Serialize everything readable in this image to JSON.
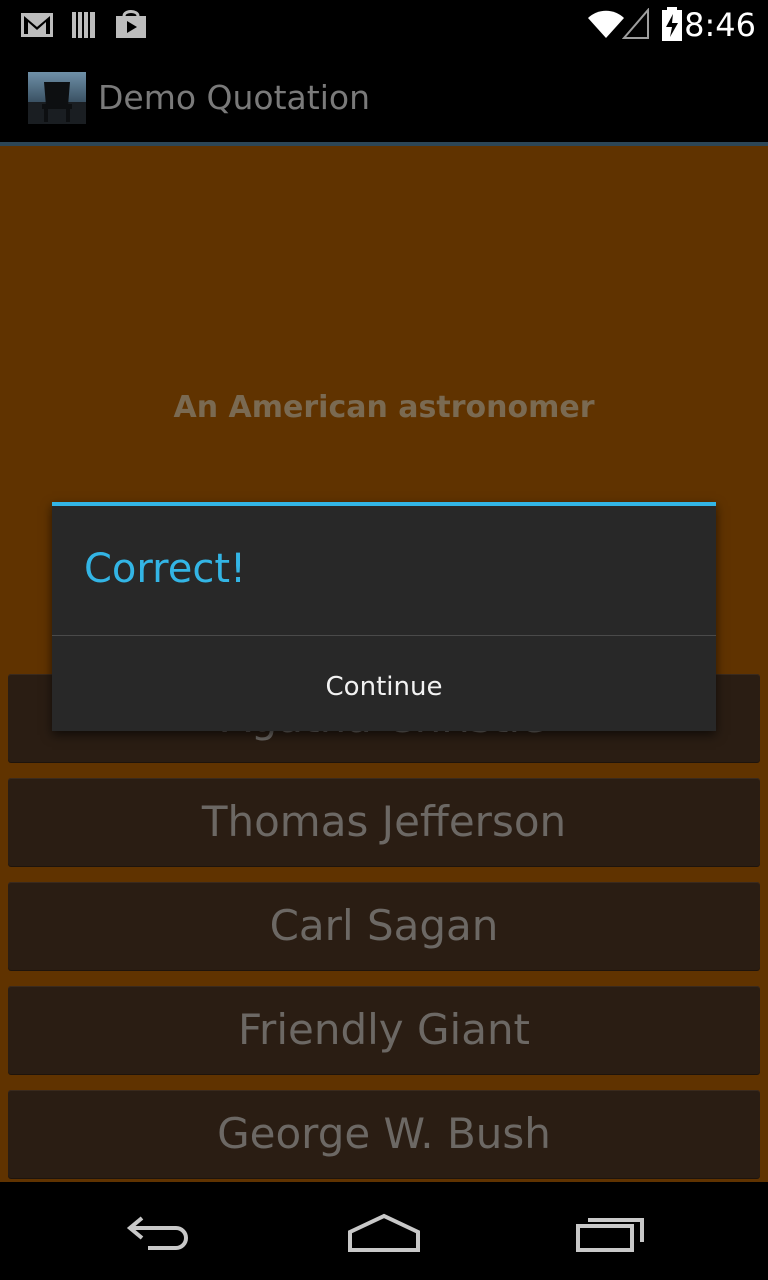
{
  "status_bar": {
    "time": "8:46",
    "icons": [
      "gmail-icon",
      "library-icon",
      "play-store-icon",
      "wifi-icon",
      "signal-icon",
      "battery-charging-icon"
    ]
  },
  "action_bar": {
    "title": "Demo Quotation",
    "icon": "app-chair-icon"
  },
  "main": {
    "clue": "An American astronomer",
    "answers": [
      {
        "label": "Agatha Christie"
      },
      {
        "label": "Thomas Jefferson"
      },
      {
        "label": "Carl Sagan"
      },
      {
        "label": "Friendly Giant"
      },
      {
        "label": "George W. Bush"
      }
    ]
  },
  "dialog": {
    "title": "Correct!",
    "button_label": "Continue"
  },
  "nav_bar": {
    "icons": [
      "back-icon",
      "home-icon",
      "recents-icon"
    ]
  },
  "colors": {
    "background": "#603300",
    "accent": "#33b5e5",
    "dialog": "#282828",
    "button": "#2a1d13"
  }
}
